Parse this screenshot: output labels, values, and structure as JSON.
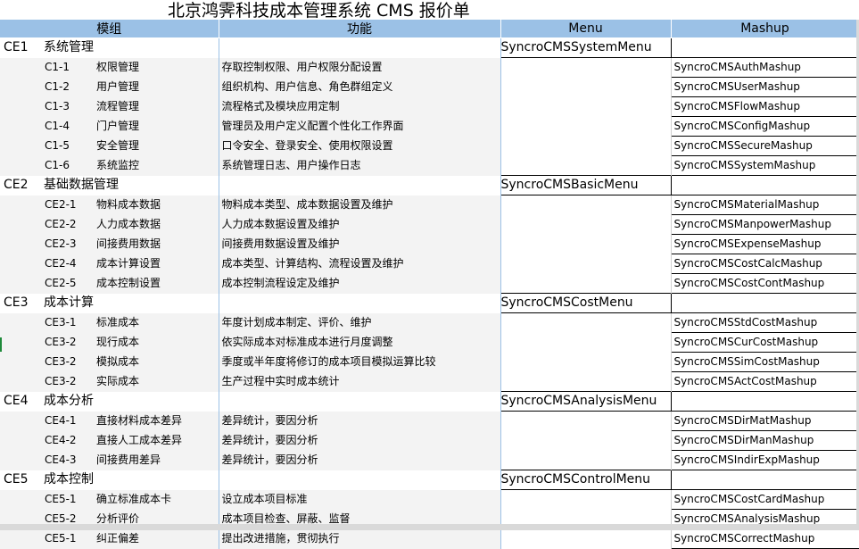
{
  "title": "北京鸿霁科技成本管理系统 CMS 报价单",
  "headers": {
    "module": "模组",
    "function": "功能",
    "menu": "Menu",
    "mashup": "Mashup"
  },
  "groups": [
    {
      "code": "CE1",
      "name": "系统管理",
      "menu": "SyncroCMSSystemMenu",
      "items": [
        {
          "code": "C1-1",
          "name": "权限管理",
          "desc": "存取控制权限、用户权限分配设置",
          "mashup": "SyncroCMSAuthMashup"
        },
        {
          "code": "C1-2",
          "name": "用户管理",
          "desc": "组织机构、用户信息、角色群组定义",
          "mashup": "SyncroCMSUserMashup"
        },
        {
          "code": "C1-3",
          "name": "流程管理",
          "desc": "流程格式及模块应用定制",
          "mashup": "SyncroCMSFlowMashup"
        },
        {
          "code": "C1-4",
          "name": "门户管理",
          "desc": "管理员及用户定义配置个性化工作界面",
          "mashup": "SyncroCMSConfigMashup"
        },
        {
          "code": "C1-5",
          "name": "安全管理",
          "desc": "口令安全、登录安全、使用权限设置",
          "mashup": "SyncroCMSSecureMashup"
        },
        {
          "code": "C1-6",
          "name": "系统监控",
          "desc": "系统管理日志、用户操作日志",
          "mashup": "SyncroCMSSystemMashup"
        }
      ]
    },
    {
      "code": "CE2",
      "name": "基础数据管理",
      "menu": "SyncroCMSBasicMenu",
      "items": [
        {
          "code": "CE2-1",
          "name": "物料成本数据",
          "desc": "物料成本类型、成本数据设置及维护",
          "mashup": "SyncroCMSMaterialMashup"
        },
        {
          "code": "CE2-2",
          "name": "人力成本数据",
          "desc": "人力成本数据设置及维护",
          "mashup": "SyncroCMSManpowerMashup"
        },
        {
          "code": "CE2-3",
          "name": "间接费用数据",
          "desc": "间接费用数据设置及维护",
          "mashup": "SyncroCMSExpenseMashup"
        },
        {
          "code": "CE2-4",
          "name": "成本计算设置",
          "desc": "成本类型、计算结构、流程设置及维护",
          "mashup": "SyncroCMSCostCalcMashup"
        },
        {
          "code": "CE2-5",
          "name": "成本控制设置",
          "desc": "成本控制流程设定及维护",
          "mashup": "SyncroCMSCostContMashup"
        }
      ]
    },
    {
      "code": "CE3",
      "name": "成本计算",
      "menu": "SyncroCMSCostMenu",
      "items": [
        {
          "code": "CE3-1",
          "name": "标准成本",
          "desc": "年度计划成本制定、评价、维护",
          "mashup": "SyncroCMSStdCostMashup"
        },
        {
          "code": "CE3-2",
          "name": "现行成本",
          "desc": "依实际成本对标准成本进行月度调整",
          "mashup": "SyncroCMSCurCostMashup"
        },
        {
          "code": "CE3-2",
          "name": "模拟成本",
          "desc": "季度或半年度将修订的成本项目模拟运算比较",
          "mashup": "SyncroCMSSimCostMashup"
        },
        {
          "code": "CE3-2",
          "name": "实际成本",
          "desc": "生产过程中实时成本统计",
          "mashup": "SyncroCMSActCostMashup"
        }
      ]
    },
    {
      "code": "CE4",
      "name": "成本分析",
      "menu": "SyncroCMSAnalysisMenu",
      "items": [
        {
          "code": "CE4-1",
          "name": "直接材料成本差异",
          "desc": "差异统计，要因分析",
          "mashup": "SyncroCMSDirMatMashup"
        },
        {
          "code": "CE4-2",
          "name": "直接人工成本差异",
          "desc": "差异统计，要因分析",
          "mashup": "SyncroCMSDirManMashup"
        },
        {
          "code": "CE4-3",
          "name": "间接费用差异",
          "desc": "差异统计，要因分析",
          "mashup": "SyncroCMSIndirExpMashup"
        }
      ]
    },
    {
      "code": "CE5",
      "name": "成本控制",
      "menu": "SyncroCMSControlMenu",
      "items": [
        {
          "code": "CE5-1",
          "name": "确立标准成本卡",
          "desc": "设立成本项目标准",
          "mashup": "SyncroCMSCostCardMashup"
        },
        {
          "code": "CE5-2",
          "name": "分析评价",
          "desc": "成本项目检查、屏蔽、监督",
          "mashup": "SyncroCMSAnalysisMashup"
        },
        {
          "code": "CE5-1",
          "name": "纠正偏差",
          "desc": "提出改进措施，贯彻执行",
          "mashup": "SyncroCMSCorrectMashup"
        }
      ]
    }
  ]
}
